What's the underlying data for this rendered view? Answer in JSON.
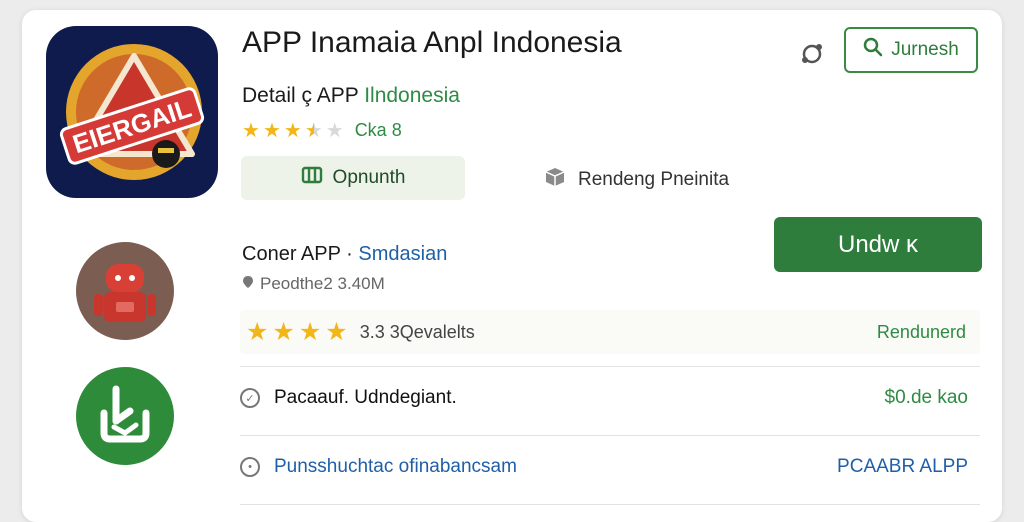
{
  "app": {
    "title": "APP Inamaia Anpl Indonesia",
    "subtitle_prefix": "Detail ç APP",
    "subtitle_highlight": "Ilndonesia",
    "icon_name": "app-logo-icon",
    "logo_text": "EIERGAIL"
  },
  "header": {
    "share_icon": "share-icon",
    "search_button_label": "Jurnesh",
    "search_icon": "search-icon"
  },
  "rating_top": {
    "value": 3.5,
    "text": "Cka 8"
  },
  "buttons": {
    "open_label": "Opnunth",
    "open_icon": "book-icon",
    "pending_label": "Rendeng Pneinita",
    "pending_icon": "box-icon",
    "install_label": "Undw ĸ"
  },
  "developer": {
    "prefix": "Coner APP ·",
    "name": "Smdasian",
    "size_text": "Peodthe2 3.40M"
  },
  "rating_row": {
    "value": 4,
    "text": "3.3 3Qevalelts",
    "right_text": "Rendunerd"
  },
  "info_rows": [
    {
      "label": "Pacaauf. Udndegiant.",
      "value": "$0.de kao",
      "icon": "check-circle-icon"
    },
    {
      "label": "Punsshuchtac ofinabancsam",
      "value": "PCAABR ALPP",
      "icon": "info-circle-icon"
    }
  ],
  "colors": {
    "accent_green": "#2e7d3c",
    "link_blue": "#1f5fa8",
    "star_yellow": "#f2b619"
  }
}
